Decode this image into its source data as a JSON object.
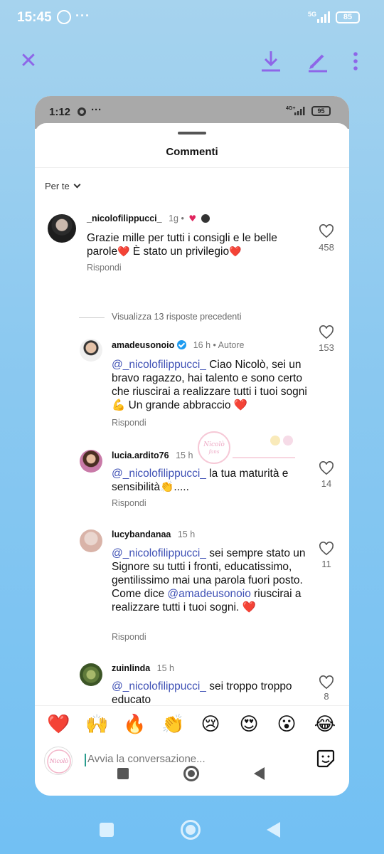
{
  "outer_status": {
    "time": "15:45",
    "network": "5G",
    "battery": "85"
  },
  "inner_status": {
    "time": "1:12",
    "network": "4G+",
    "battery": "95"
  },
  "sheet": {
    "title": "Commenti",
    "sort_label": "Per te"
  },
  "comments": [
    {
      "username": "_nicolofilippucci_",
      "meta": "1g •",
      "text_parts": [
        "Grazie mille per tutti i consigli e le belle parole",
        "❤️",
        " È stato un privilegio",
        "❤️"
      ],
      "reply": "Rispondi",
      "likes": "458"
    },
    {
      "username": "amadeusonoio",
      "meta": "16 h • Autore",
      "mention": "@_nicolofilippucci_",
      "text": " Ciao Nicolò, sei un bravo ragazzo, hai talento e sono certo che riuscirai a realizzare tutti i tuoi sogni💪 Un grande abbraccio ❤️",
      "reply": "Rispondi",
      "likes": "153"
    },
    {
      "username": "lucia.ardito76",
      "meta": "15 h",
      "mention": "@_nicolofilippucci_",
      "text": " la tua maturità e sensibilità👏.....",
      "reply": "Rispondi",
      "likes": "14"
    },
    {
      "username": "lucybandanaa",
      "meta": "15 h",
      "mention": "@_nicolofilippucci_",
      "text_a": " sei sempre stato un Signore su tutti i fronti, educatissimo, gentilissimo mai una parola fuori posto. Come dice ",
      "mention_b": "@amadeusonoio",
      "text_b": " riuscirai a realizzare tutti i tuoi sogni. ❤️",
      "reply": "Rispondi",
      "likes": "11"
    },
    {
      "username": "zuinlinda",
      "meta": "15 h",
      "mention": "@_nicolofilippucci_",
      "text": " sei troppo troppo educato",
      "likes": "8"
    }
  ],
  "view_previous": "Visualizza 13 risposte precedenti",
  "reactions": [
    "❤️",
    "🙌",
    "🔥",
    "👏",
    "😢",
    "😍",
    "😮",
    "😂"
  ],
  "input": {
    "placeholder": "Avvia la conversazione..."
  },
  "colors": {
    "accent": "#8e66e8",
    "mention": "#3f51b5",
    "background": "#8cc9f0"
  }
}
